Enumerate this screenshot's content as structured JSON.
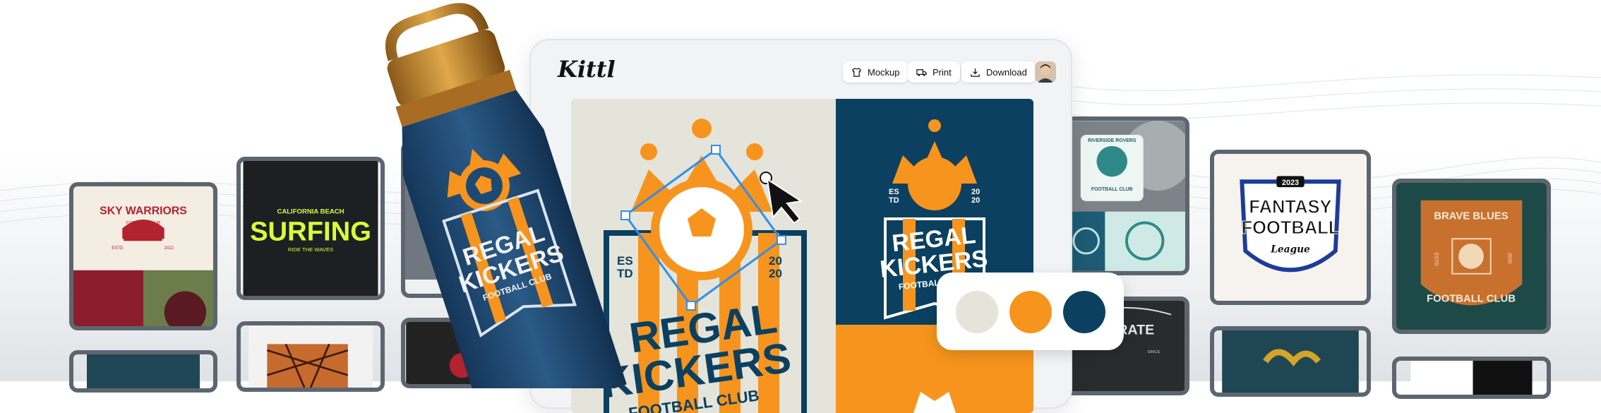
{
  "editor": {
    "logo": "Kittl",
    "buttons": {
      "mockup": "Mockup",
      "print": "Print",
      "download": "Download"
    }
  },
  "design": {
    "estd": "ES\nTD",
    "year": "20\n20",
    "line1": "REGAL",
    "line2": "KICKERS",
    "sub": "FOOTBALL CLUB"
  },
  "palette": {
    "colors": [
      "#e4e4da",
      "#f7941d",
      "#0b4060"
    ]
  },
  "tiles": {
    "sky": {
      "title": "SKY WARRIORS",
      "sub": "FOOTBALL CLUB",
      "estd": "ESTD",
      "year": "2022"
    },
    "surf": {
      "top": "CALIFORNIA BEACH",
      "main": "SURFING",
      "bottom": "RIDE THE WAVES"
    },
    "riverside": {
      "title": "RIVERSIDE ROVERS",
      "sub": "FOOTBALL CLUB"
    },
    "fantasy": {
      "year": "2023",
      "line1": "FANTASY",
      "line2": "FOOTBALL",
      "line3": "League"
    },
    "brave": {
      "title": "BRAVE BLUES",
      "sub": "FOOTBALL CLUB",
      "estd": "ESTD",
      "year": "2020"
    },
    "karate": {
      "title": "KARATE",
      "since": "SINCE"
    }
  }
}
